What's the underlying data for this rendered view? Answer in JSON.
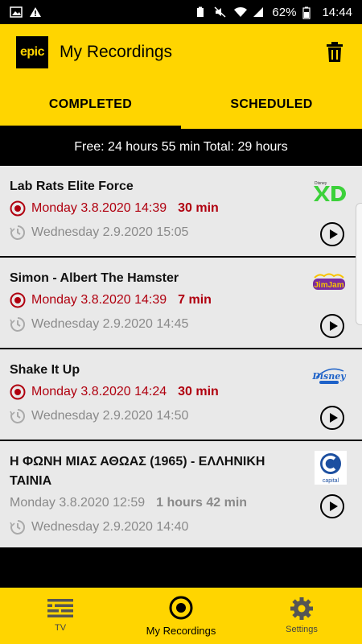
{
  "status_bar": {
    "battery": "62%",
    "time": "14:44"
  },
  "app_bar": {
    "logo_text": "epic",
    "title": "My Recordings"
  },
  "tabs": [
    {
      "label": "COMPLETED",
      "active": true
    },
    {
      "label": "SCHEDULED",
      "active": false
    }
  ],
  "storage": {
    "free": "Free: 24 hours 55 min",
    "total": "Total: 29 hours"
  },
  "recordings": [
    {
      "title": "Lab Rats Elite Force",
      "recorded": "Monday 3.8.2020 14:39",
      "duration": "30 min",
      "expires": "Wednesday 2.9.2020 15:05",
      "channel": "disney-xd",
      "state": "recorded"
    },
    {
      "title": "Simon - Albert The Hamster",
      "recorded": "Monday 3.8.2020 14:39",
      "duration": "7 min",
      "expires": "Wednesday 2.9.2020 14:45",
      "channel": "jimjam",
      "state": "recorded"
    },
    {
      "title": "Shake It Up",
      "recorded": "Monday 3.8.2020 14:24",
      "duration": "30 min",
      "expires": "Wednesday 2.9.2020 14:50",
      "channel": "disney-channel",
      "state": "recorded"
    },
    {
      "title": "Η ΦΩΝΗ ΜΙΑΣ ΑΘΩΑΣ (1965) - ΕΛΛΗΝΙΚΗ ΤΑΙΝΙΑ",
      "recorded": "Monday 3.8.2020 12:59",
      "duration": "1 hours 42 min",
      "expires": "Wednesday 2.9.2020 14:40",
      "channel": "capital",
      "state": "muted"
    }
  ],
  "channel_logos": {
    "jimjam": "JimJam",
    "disney": "Disney",
    "capital": "capital"
  },
  "bottom_nav": [
    {
      "label": "TV",
      "icon": "tv-guide-icon",
      "active": false
    },
    {
      "label": "My Recordings",
      "icon": "record-icon",
      "active": true
    },
    {
      "label": "Settings",
      "icon": "gear-icon",
      "active": false
    }
  ],
  "colors": {
    "brand_yellow": "#FFD500",
    "record_red": "#B0000F",
    "muted_gray": "#8a8a8a",
    "card_bg": "#E9E9E9"
  }
}
